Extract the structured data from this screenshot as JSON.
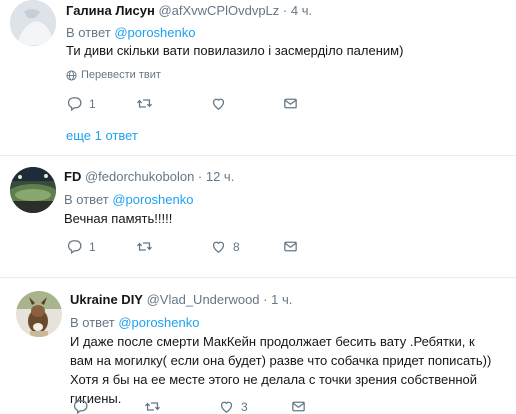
{
  "tweets": [
    {
      "name": "Галина Лисун",
      "handle": "@afXvwCPlOvdvpLz",
      "time": "· 4 ч.",
      "reply_prefix": "В ответ",
      "reply_to": "@poroshenko",
      "text": "Ти диви скільки вати повилазило і засмерділо паленим)",
      "translate": "Перевести твит",
      "reply_count": "1",
      "retweet_count": "",
      "like_count": "",
      "more_replies": "еще 1 ответ"
    },
    {
      "name": "FD",
      "handle": "@fedorchukobolon",
      "time": "· 12 ч.",
      "reply_prefix": "В ответ",
      "reply_to": "@poroshenko",
      "text": "Вечная память!!!!!",
      "reply_count": "1",
      "retweet_count": "",
      "like_count": "8"
    },
    {
      "name": "Ukraine DIY",
      "handle": "@Vlad_Underwood",
      "time": "· 1 ч.",
      "reply_prefix": "В ответ",
      "reply_to": "@poroshenko",
      "text": "И даже после смерти МакКейн продолжает бесить вату .Ребятки, к вам на могилку( если она будет) разве что собачка придет пописать)) Хотя я бы на ее месте этого не делала  с точки зрения собственной гигиены.",
      "reply_count": "",
      "retweet_count": "",
      "like_count": "3"
    }
  ],
  "icons": {
    "reply": "reply-icon",
    "retweet": "retweet-icon",
    "like": "like-icon",
    "dm": "direct-message-icon",
    "translate": "globe-icon"
  },
  "colors": {
    "link": "#1da1f2",
    "muted": "#657786",
    "text": "#14171a",
    "divider": "#e6ecf0"
  }
}
